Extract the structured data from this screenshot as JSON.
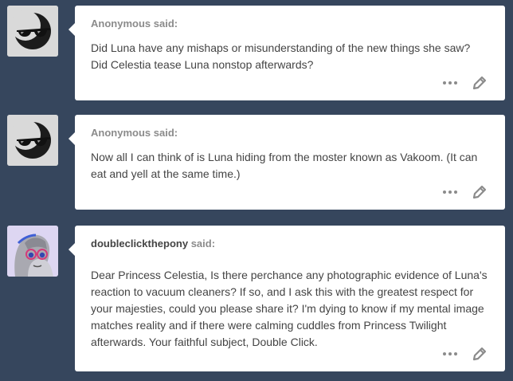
{
  "posts": [
    {
      "asker": "Anonymous",
      "said_label": "said:",
      "question": "Did Luna have any mishaps or misunderstanding of the new things she saw? Did Celestia tease Luna nonstop afterwards?",
      "avatar_icon": "sunglasses-moon-icon"
    },
    {
      "asker": "Anonymous",
      "said_label": "said:",
      "question": "Now all I can think of is Luna hiding from the moster known as Vakoom. (It can eat and yell at the same time.)",
      "avatar_icon": "sunglasses-moon-icon"
    },
    {
      "asker": "doubleclickthepony",
      "said_label": "said:",
      "question": "Dear Princess Celestia, Is there perchance any photographic evidence of Luna's reaction to vacuum cleaners? If so, and I ask this with the greatest respect for your majesties, could you please share it? I'm dying to know if my mental image matches reality and if there were calming cuddles from Princess Twilight afterwards. Your faithful subject, Double Click.",
      "avatar_icon": "pony-avatar-icon"
    }
  ],
  "icons": {
    "more": "more-dots-icon",
    "edit": "pencil-icon"
  },
  "colors": {
    "background": "#36465d",
    "card": "#ffffff",
    "text": "#444444",
    "muted": "#8b8b8b"
  }
}
